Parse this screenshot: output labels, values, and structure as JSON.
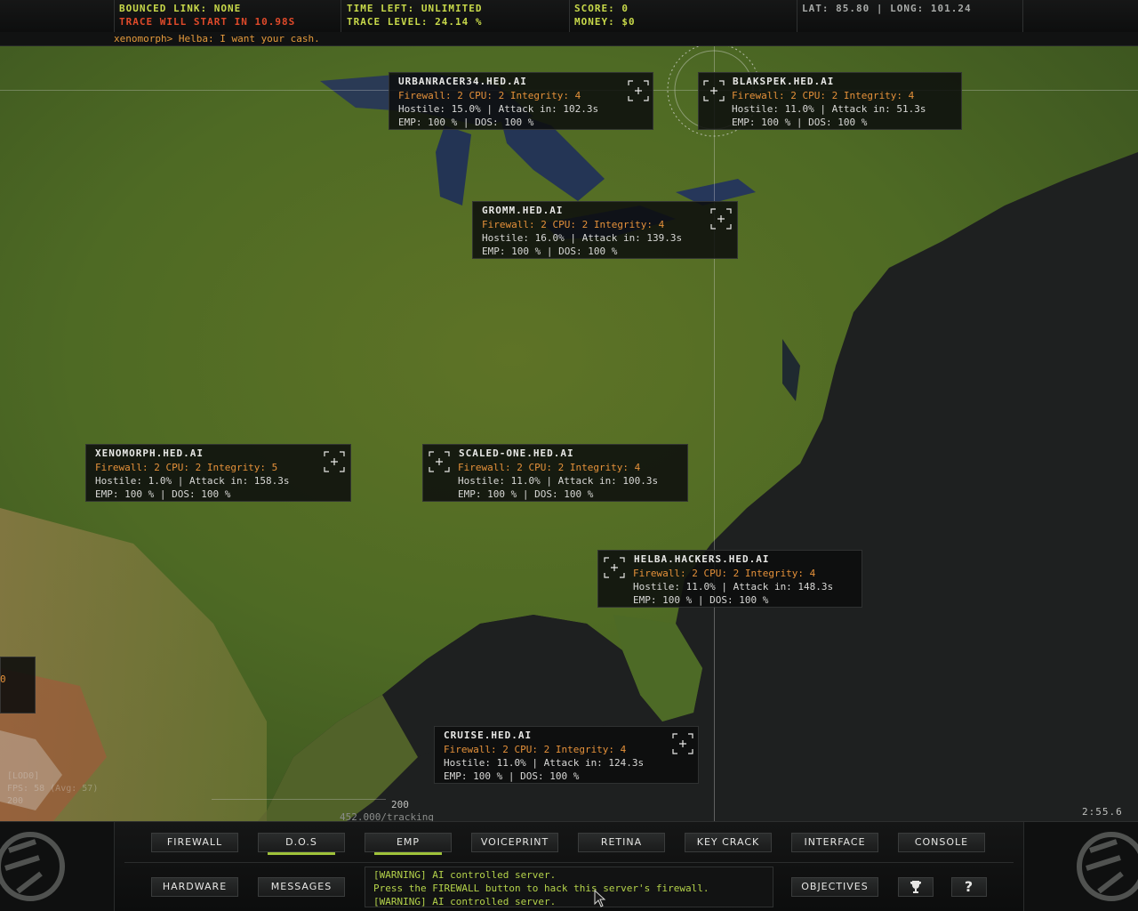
{
  "hud": {
    "bounced_link": "Bounced link: none",
    "trace_warning": "Trace will start in 10.98s",
    "time_left": "Time left: unlimited",
    "trace_level": "Trace level: 24.14 %",
    "score": "Score: 0",
    "money": "Money: $0",
    "coords": "LAT: 85.80 | LONG: 101.24"
  },
  "chat": {
    "line": "xenomorph> Helba: I want your cash."
  },
  "servers": [
    {
      "name": "urbanracer34.hed.ai",
      "firewall": "Firewall: 2 CPU: 2 Integrity: 4",
      "hostile": "Hostile: 15.0% | Attack in: 102.3s",
      "emp": "EMP: 100 % | DOS: 100 %"
    },
    {
      "name": "BlakSpek.hed.ai",
      "firewall": "Firewall: 2 CPU: 2 Integrity: 4",
      "hostile": "Hostile: 11.0% | Attack in: 51.3s",
      "emp": "EMP: 100 % | DOS: 100 %"
    },
    {
      "name": "Gromm.hed.ai",
      "firewall": "Firewall: 2 CPU: 2 Integrity: 4",
      "hostile": "Hostile: 16.0% | Attack in: 139.3s",
      "emp": "EMP: 100 % | DOS: 100 %"
    },
    {
      "name": "xenomorph.hed.ai",
      "firewall": "Firewall: 2 CPU: 2 Integrity: 5",
      "hostile": "Hostile: 1.0% | Attack in: 158.3s",
      "emp": "EMP: 100 % | DOS: 100 %"
    },
    {
      "name": "scaled-one.hed.ai",
      "firewall": "Firewall: 2 CPU: 2 Integrity: 4",
      "hostile": "Hostile: 11.0% | Attack in: 100.3s",
      "emp": "EMP: 100 % | DOS: 100 %"
    },
    {
      "name": "Helba.Hackers.hed.ai",
      "firewall": "Firewall: 2 CPU: 2 Integrity: 4",
      "hostile": "Hostile: 11.0% | Attack in: 148.3s",
      "emp": "EMP: 100 % | DOS: 100 %"
    },
    {
      "name": "cruise.hed.ai",
      "firewall": "Firewall: 2 CPU: 2 Integrity: 4",
      "hostile": "Hostile: 11.0% | Attack in: 124.3s",
      "emp": "EMP: 100 % | DOS: 100 %"
    }
  ],
  "stub_panel_text": "0",
  "debug": {
    "line1": "[LOD0]",
    "line2": "FPS: 58 (Avg: 57)",
    "line3": "200"
  },
  "fps_scale_label": "200",
  "tracking": "452.000/tracking",
  "clock": "2:55.6",
  "buttons": {
    "firewall": "Firewall",
    "dos": "D.O.S",
    "emp": "EMP",
    "voiceprint": "Voiceprint",
    "retina": "Retina",
    "key_crack": "Key Crack",
    "interface": "Interface",
    "console": "Console",
    "hardware": "Hardware",
    "messages": "Messages",
    "objectives": "Objectives",
    "help": "?"
  },
  "messages": [
    "[WARNING] AI controlled server.",
    "Press the FIREWALL button to hack this server's firewall.",
    "[WARNING] AI controlled server."
  ],
  "colors": {
    "accent_green": "#9fc23a",
    "hud_yellow": "#c8d94a",
    "warning_red": "#e04a2a",
    "firewall_orange": "#e5913a",
    "message_green": "#b4d24a"
  },
  "icons": [
    "target-reticle-icon",
    "trophy-icon",
    "help-icon",
    "hed-logo-icon",
    "mouse-cursor-icon"
  ]
}
